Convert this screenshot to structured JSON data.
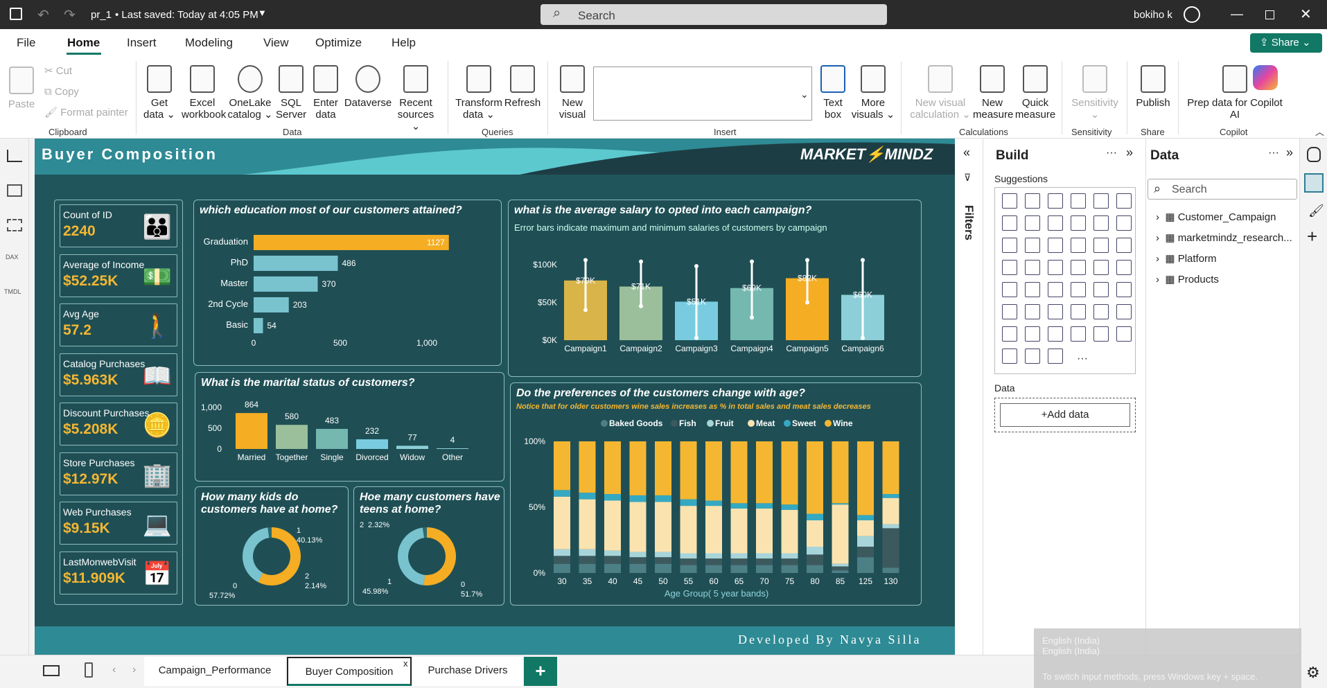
{
  "app": {
    "file": "pr_1",
    "saved": "• Last saved: Today at 4:05 PM",
    "search_placeholder": "Search",
    "user": "bokiho k",
    "share": "Share"
  },
  "menu": [
    "File",
    "Home",
    "Insert",
    "Modeling",
    "View",
    "Optimize",
    "Help"
  ],
  "ribbon": {
    "clipboard": [
      "Paste",
      "Cut",
      "Copy",
      "Format painter"
    ],
    "data_btns": [
      [
        "Get",
        "data ⌄"
      ],
      [
        "Excel",
        "workbook"
      ],
      [
        "OneLake",
        "catalog ⌄"
      ],
      [
        "SQL",
        "Server"
      ],
      [
        "Enter",
        "data"
      ],
      [
        "Dataverse",
        ""
      ],
      [
        "Recent",
        "sources ⌄"
      ]
    ],
    "queries_btns": [
      [
        "Transform",
        "data ⌄"
      ],
      [
        "Refresh",
        ""
      ]
    ],
    "insert_btns": [
      [
        "New",
        "visual"
      ],
      [
        "Text",
        "box"
      ],
      [
        "More",
        "visuals ⌄"
      ]
    ],
    "calc_btns": [
      [
        "New visual",
        "calculation ⌄"
      ],
      [
        "New",
        "measure"
      ],
      [
        "Quick",
        "measure"
      ]
    ],
    "sens": [
      "Sensitivity",
      "⌄"
    ],
    "publish": "Publish",
    "copilot": [
      "Prep data for Copilot",
      "AI"
    ],
    "groups": [
      "Clipboard",
      "Data",
      "Queries",
      "Insert",
      "Calculations",
      "Sensitivity",
      "Share",
      "Copilot"
    ]
  },
  "report": {
    "title": "Buyer Composition",
    "logo": "MARKET⚡MINDZ",
    "footer": "Developed By Navya Silla"
  },
  "kpis": [
    {
      "label": "Count of ID",
      "value": "2240",
      "icon": "people-icon"
    },
    {
      "label": "Average of Income",
      "value": "$52.25K",
      "icon": "money-icon"
    },
    {
      "label": "Avg Age",
      "value": "57.2",
      "icon": "elder-icon"
    },
    {
      "label": "Catalog Purchases",
      "value": "$5.963K",
      "icon": "book-icon"
    },
    {
      "label": "Discount Purchases",
      "value": "$5.208K",
      "icon": "coins-icon"
    },
    {
      "label": "Store Purchases",
      "value": "$12.97K",
      "icon": "building-icon"
    },
    {
      "label": "Web Purchases",
      "value": "$9.15K",
      "icon": "laptop-icon"
    },
    {
      "label": "LastMonwebVisit",
      "value": "$11.909K",
      "icon": "calendar-icon"
    }
  ],
  "chart_data": [
    {
      "type": "bar",
      "orientation": "horizontal",
      "title": "which education most of our customers attained?",
      "categories": [
        "Graduation",
        "PhD",
        "Master",
        "2nd Cycle",
        "Basic"
      ],
      "values": [
        1127,
        486,
        370,
        203,
        54
      ],
      "ticks": [
        "0",
        "500",
        "1,000"
      ],
      "xlim": [
        0,
        1200
      ]
    },
    {
      "type": "bar",
      "title": "what is the average salary to opted into each campaign?",
      "subtitle": "Error bars indicate maximum and minimum salaries of customers by campaign",
      "categories": [
        "Campaign1",
        "Campaign2",
        "Campaign3",
        "Campaign4",
        "Campaign5",
        "Campaign6"
      ],
      "values": [
        79,
        71,
        51,
        69,
        82,
        60
      ],
      "labels": [
        "$79K",
        "$71K",
        "$51K",
        "$69K",
        "$82K",
        "$60K"
      ],
      "err_max": [
        106,
        104,
        98,
        104,
        106,
        106
      ],
      "err_min": [
        40,
        45,
        3,
        30,
        50,
        3
      ],
      "colors": [
        "#d9b448",
        "#9bbf9a",
        "#79cce0",
        "#74b8b0",
        "#f5ad24",
        "#8dcfd8"
      ],
      "ticks": [
        "$0K",
        "$50K",
        "$100K"
      ],
      "ylim": [
        0,
        110
      ]
    },
    {
      "type": "bar",
      "title": "What is the marital status of customers?",
      "categories": [
        "Married",
        "Together",
        "Single",
        "Divorced",
        "Widow",
        "Other"
      ],
      "values": [
        864,
        580,
        483,
        232,
        77,
        4
      ],
      "colors": [
        "#f5ad24",
        "#9bbf9a",
        "#74b8b0",
        "#79cce0",
        "#8dcfd8",
        "#8dcfd8"
      ],
      "ticks": [
        "0",
        "500",
        "1,000"
      ],
      "ylim": [
        0,
        1100
      ]
    },
    {
      "type": "pie",
      "title": "How many kids do customers have at home?",
      "slices": [
        {
          "name": "0",
          "value": 57.72,
          "label": "57.72%",
          "color": "#f5ad24"
        },
        {
          "name": "1",
          "value": 40.13,
          "label": "40.13%",
          "color": "#79c3cf"
        },
        {
          "name": "2",
          "value": 2.14,
          "label": "2.14%",
          "color": "#2d6b70"
        }
      ]
    },
    {
      "type": "pie",
      "title": "Hoe many customers have teens at home?",
      "slices": [
        {
          "name": "0",
          "value": 51.7,
          "label": "51.7%",
          "color": "#f5ad24"
        },
        {
          "name": "1",
          "value": 45.98,
          "label": "45.98%",
          "color": "#79c3cf"
        },
        {
          "name": "2",
          "value": 2.32,
          "label": "2.32%",
          "color": "#2d6b70"
        }
      ]
    },
    {
      "type": "bar",
      "stacked": "percent",
      "title": "Do the preferences of the customers change with age?",
      "subtitle": "Notice that for older customers wine sales increases  as % in total sales  and meat sales decreases",
      "xlabel": "Age Group( 5 year bands)",
      "categories": [
        "30",
        "35",
        "40",
        "45",
        "50",
        "55",
        "60",
        "65",
        "70",
        "75",
        "80",
        "85",
        "125",
        "130"
      ],
      "ticks": [
        "0%",
        "50%",
        "100%"
      ],
      "series": [
        {
          "name": "Baked Goods",
          "color": "#4d7f86",
          "values": [
            7,
            7,
            7,
            7,
            7,
            6,
            6,
            6,
            6,
            6,
            6,
            2,
            12,
            4
          ]
        },
        {
          "name": "Fish",
          "color": "#3c5a5e",
          "values": [
            6,
            6,
            6,
            5,
            5,
            5,
            5,
            5,
            5,
            5,
            8,
            3,
            8,
            30
          ]
        },
        {
          "name": "Fruit",
          "color": "#a8d5da",
          "values": [
            5,
            5,
            4,
            4,
            4,
            4,
            4,
            4,
            4,
            4,
            6,
            2,
            8,
            3
          ]
        },
        {
          "name": "Meat",
          "color": "#fbe3b0",
          "values": [
            40,
            38,
            38,
            38,
            38,
            36,
            36,
            34,
            34,
            33,
            20,
            45,
            12,
            20
          ]
        },
        {
          "name": "Sweet",
          "color": "#35a9c2",
          "values": [
            5,
            5,
            5,
            5,
            5,
            5,
            4,
            4,
            4,
            4,
            5,
            1,
            4,
            3
          ]
        },
        {
          "name": "Wine",
          "color": "#f5b731",
          "values": [
            37,
            39,
            40,
            41,
            41,
            44,
            45,
            47,
            47,
            48,
            55,
            47,
            56,
            40
          ]
        }
      ]
    }
  ],
  "pages": [
    "Campaign_Performance",
    "Buyer Composition",
    "Purchase Drivers"
  ],
  "build": {
    "title": "Build",
    "suggestions": "Suggestions",
    "data": "Data",
    "add": "+Add data"
  },
  "datapane": {
    "title": "Data",
    "search": "Search",
    "tables": [
      "Customer_Campaign",
      "marketmindz_research...",
      "Platform",
      "Products"
    ]
  },
  "filters": "Filters",
  "toast": [
    "English (India)",
    "English (India)",
    "To switch input methods, press Windows key + space."
  ]
}
